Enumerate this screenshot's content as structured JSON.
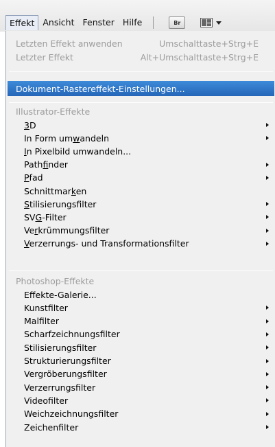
{
  "menubar": {
    "items": [
      {
        "label": "Effekt",
        "active": true
      },
      {
        "label": "Ansicht"
      },
      {
        "label": "Fenster"
      },
      {
        "label": "Hilfe"
      }
    ],
    "bridge_label": "Br"
  },
  "dropdown": {
    "recent": [
      {
        "label": "Letzten Effekt anwenden",
        "shortcut": "Umschalttaste+Strg+E"
      },
      {
        "label": "Letzter Effekt",
        "shortcut": "Alt+Umschalttaste+Strg+E"
      }
    ],
    "doc_settings": "Dokument-Rastereffekt-Einstellungen...",
    "illustrator_header": "Illustrator-Effekte",
    "illustrator_items": [
      {
        "pre": "",
        "ul": "3",
        "post": "D",
        "submenu": true
      },
      {
        "pre": "In Form um",
        "ul": "w",
        "post": "andeln",
        "submenu": true
      },
      {
        "pre": "",
        "ul": "I",
        "post": "n Pixelbild umwandeln...",
        "submenu": false
      },
      {
        "pre": "Path",
        "ul": "f",
        "post": "inder",
        "submenu": true
      },
      {
        "pre": "",
        "ul": "P",
        "post": "fad",
        "submenu": true
      },
      {
        "pre": "Schnittmar",
        "ul": "k",
        "post": "en",
        "submenu": false
      },
      {
        "pre": "",
        "ul": "S",
        "post": "tilisierungsfilter",
        "submenu": true
      },
      {
        "pre": "SV",
        "ul": "G",
        "post": "-Filter",
        "submenu": true
      },
      {
        "pre": "Ve",
        "ul": "r",
        "post": "krümmungsfilter",
        "submenu": true
      },
      {
        "pre": "",
        "ul": "V",
        "post": "erzerrungs- und Transformationsfilter",
        "submenu": true
      }
    ],
    "photoshop_header": "Photoshop-Effekte",
    "photoshop_items": [
      {
        "label": "Effekte-Galerie...",
        "submenu": false
      },
      {
        "label": "Kunstfilter",
        "submenu": true
      },
      {
        "label": "Malfilter",
        "submenu": true
      },
      {
        "label": "Scharfzeichnungsfilter",
        "submenu": true
      },
      {
        "label": "Stilisierungsfilter",
        "submenu": true
      },
      {
        "label": "Strukturierungsfilter",
        "submenu": true
      },
      {
        "label": "Vergröberungsfilter",
        "submenu": true
      },
      {
        "label": "Verzerrungsfilter",
        "submenu": true
      },
      {
        "label": "Videofilter",
        "submenu": true
      },
      {
        "label": "Weichzeichnungsfilter",
        "submenu": true
      },
      {
        "label": "Zeichenfilter",
        "submenu": true
      }
    ]
  }
}
